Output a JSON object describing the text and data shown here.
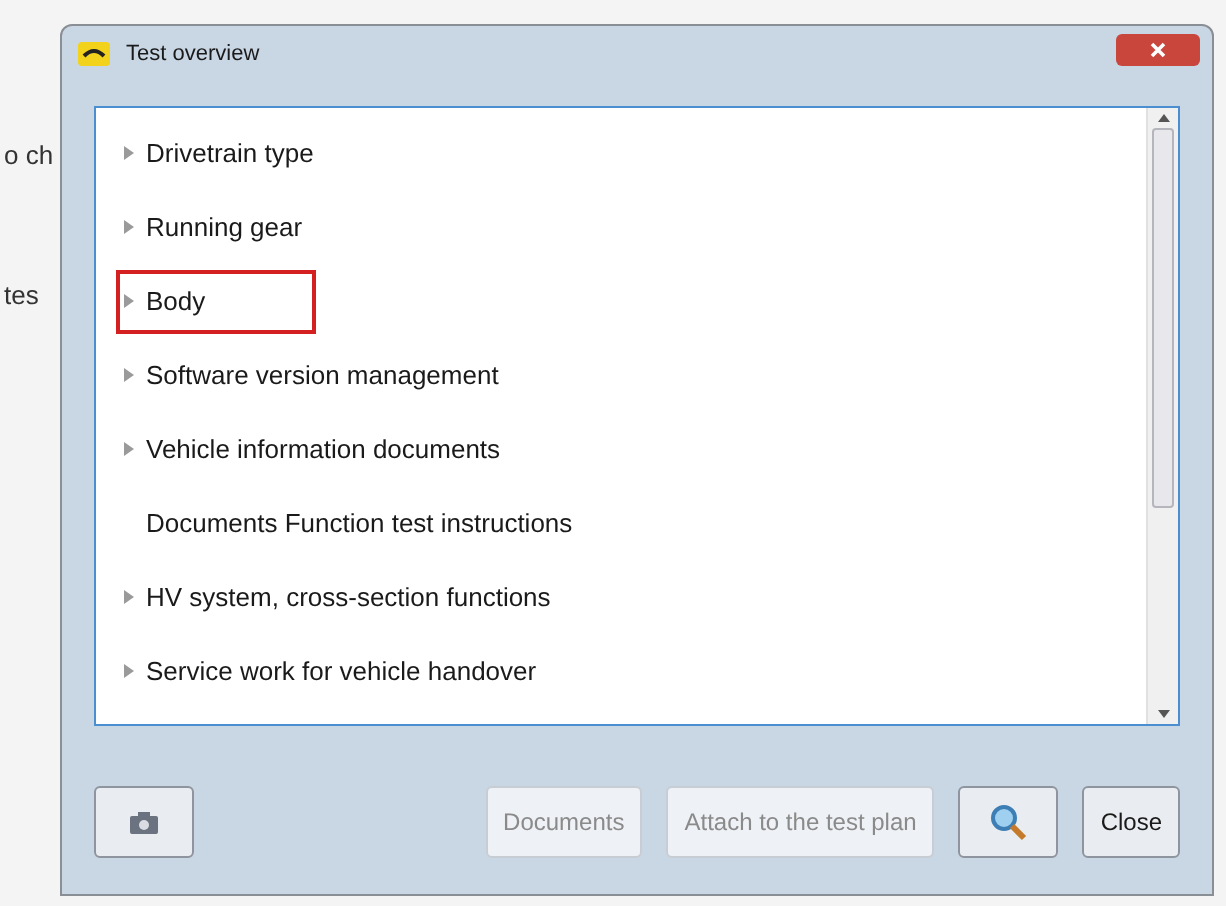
{
  "background": {
    "fragments": [
      "o ch",
      "tes"
    ]
  },
  "window": {
    "title": "Test overview"
  },
  "list": {
    "items": [
      {
        "label": "Drivetrain type",
        "kind": "group",
        "highlighted": false
      },
      {
        "label": "Running gear",
        "kind": "group",
        "highlighted": false
      },
      {
        "label": "Body",
        "kind": "group",
        "highlighted": true
      },
      {
        "label": "Software version management",
        "kind": "group",
        "highlighted": false
      },
      {
        "label": "Vehicle information documents",
        "kind": "group",
        "highlighted": false
      },
      {
        "label": "Documents Function test instructions",
        "kind": "leaf",
        "highlighted": false
      },
      {
        "label": "HV system, cross-section functions",
        "kind": "group",
        "highlighted": false
      },
      {
        "label": "Service work for vehicle handover",
        "kind": "group",
        "highlighted": false
      }
    ]
  },
  "buttons": [
    {
      "kind": "camera",
      "disabled": false
    },
    {
      "kind": "text",
      "label": "Documents",
      "disabled": true
    },
    {
      "kind": "text",
      "label": "Attach to the test plan",
      "disabled": true
    },
    {
      "kind": "search",
      "disabled": false
    },
    {
      "kind": "text",
      "label": "Close",
      "disabled": false
    }
  ]
}
